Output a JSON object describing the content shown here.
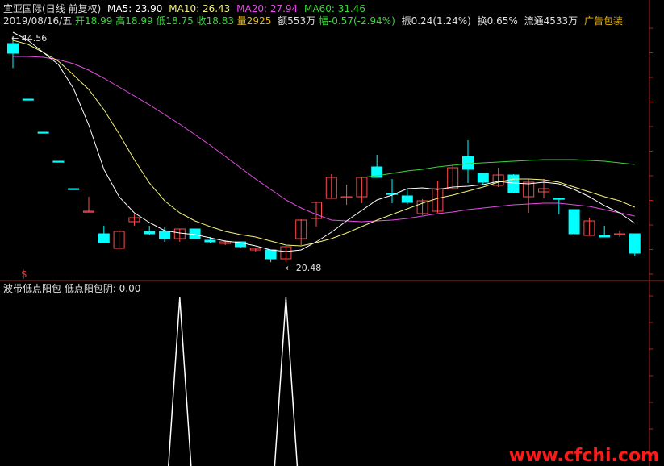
{
  "header": {
    "stock_title": "宜亚国际(日线 前复权)",
    "ma5": "MA5: 23.90",
    "ma10": "MA10: 26.43",
    "ma20": "MA20: 27.94",
    "ma60": "MA60: 31.46",
    "date": "2019/08/16/五",
    "open": "开18.99",
    "high": "高18.99",
    "low": "低18.75",
    "close": "收18.83",
    "volume": "量2925",
    "amount": "额553万",
    "change": "幅-0.57(-2.94%)",
    "amplitude": "振0.24(1.24%)",
    "turnover": "换0.65%",
    "float": "流通4533万",
    "industry": "广告包装"
  },
  "markers": {
    "high_label": "44.56",
    "low_label": "20.48",
    "dollar": "$"
  },
  "indicator": {
    "title": "波带低点阳包  低点阳包阴: 0.00"
  },
  "watermark": "www.cfchi.com",
  "colors": {
    "background": "#000000",
    "up": "#ff4b4b",
    "down": "#00ffff",
    "ma5": "#ffffff",
    "ma10": "#f5f37c",
    "ma20": "#e34ee3",
    "ma60": "#3ad63a",
    "axis": "#b22222"
  },
  "chart_data": {
    "type": "candlestick",
    "title": "宜亚国际(日线 前复权)",
    "candles": [
      {
        "o": 47.6,
        "h": 48.5,
        "l": 44.56,
        "c": 46.4,
        "dir": "down"
      },
      {
        "o": 40.7,
        "h": 40.7,
        "l": 40.7,
        "c": 40.7,
        "dir": "down"
      },
      {
        "o": 36.6,
        "h": 36.6,
        "l": 36.6,
        "c": 36.6,
        "dir": "down"
      },
      {
        "o": 33.0,
        "h": 33.0,
        "l": 33.0,
        "c": 33.0,
        "dir": "down"
      },
      {
        "o": 29.6,
        "h": 29.6,
        "l": 29.6,
        "c": 29.6,
        "dir": "down"
      },
      {
        "o": 26.7,
        "h": 28.6,
        "l": 26.7,
        "c": 26.8,
        "dir": "up"
      },
      {
        "o": 24.0,
        "h": 25.0,
        "l": 23.0,
        "c": 22.9,
        "dir": "down"
      },
      {
        "o": 22.2,
        "h": 24.6,
        "l": 22.2,
        "c": 24.3,
        "dir": "up"
      },
      {
        "o": 25.5,
        "h": 26.4,
        "l": 25.0,
        "c": 26.0,
        "dir": "up"
      },
      {
        "o": 24.3,
        "h": 25.0,
        "l": 23.8,
        "c": 24.0,
        "dir": "down"
      },
      {
        "o": 24.3,
        "h": 24.9,
        "l": 23.0,
        "c": 23.4,
        "dir": "down"
      },
      {
        "o": 23.4,
        "h": 24.6,
        "l": 23.0,
        "c": 24.6,
        "dir": "up"
      },
      {
        "o": 24.6,
        "h": 24.6,
        "l": 23.4,
        "c": 23.4,
        "dir": "down"
      },
      {
        "o": 23.2,
        "h": 23.6,
        "l": 22.8,
        "c": 23.0,
        "dir": "down"
      },
      {
        "o": 23.0,
        "h": 23.2,
        "l": 22.6,
        "c": 22.8,
        "dir": "up"
      },
      {
        "o": 23.0,
        "h": 23.0,
        "l": 22.2,
        "c": 22.4,
        "dir": "down"
      },
      {
        "o": 22.2,
        "h": 22.2,
        "l": 21.8,
        "c": 22.0,
        "dir": "up"
      },
      {
        "o": 22.0,
        "h": 22.0,
        "l": 20.48,
        "c": 20.9,
        "dir": "down"
      },
      {
        "o": 20.9,
        "h": 22.5,
        "l": 20.5,
        "c": 22.4,
        "dir": "up"
      },
      {
        "o": 23.4,
        "h": 25.8,
        "l": 22.6,
        "c": 25.7,
        "dir": "up"
      },
      {
        "o": 25.9,
        "h": 28.0,
        "l": 24.9,
        "c": 27.9,
        "dir": "up"
      },
      {
        "o": 28.4,
        "h": 31.4,
        "l": 28.4,
        "c": 31.0,
        "dir": "up"
      },
      {
        "o": 28.6,
        "h": 30.1,
        "l": 27.6,
        "c": 28.6,
        "dir": "up"
      },
      {
        "o": 28.6,
        "h": 31.0,
        "l": 27.8,
        "c": 31.0,
        "dir": "up"
      },
      {
        "o": 32.3,
        "h": 33.8,
        "l": 31.4,
        "c": 31.0,
        "dir": "down"
      },
      {
        "o": 29.0,
        "h": 30.8,
        "l": 27.8,
        "c": 29.0,
        "dir": "down"
      },
      {
        "o": 28.7,
        "h": 29.5,
        "l": 27.7,
        "c": 27.9,
        "dir": "down"
      },
      {
        "o": 26.5,
        "h": 28.3,
        "l": 26.3,
        "c": 28.1,
        "dir": "up"
      },
      {
        "o": 26.8,
        "h": 30.6,
        "l": 26.6,
        "c": 29.6,
        "dir": "up"
      },
      {
        "o": 29.6,
        "h": 32.6,
        "l": 29.6,
        "c": 32.2,
        "dir": "up"
      },
      {
        "o": 33.6,
        "h": 35.6,
        "l": 30.3,
        "c": 32.0,
        "dir": "down"
      },
      {
        "o": 31.5,
        "h": 31.5,
        "l": 30.0,
        "c": 30.4,
        "dir": "down"
      },
      {
        "o": 30.0,
        "h": 32.2,
        "l": 29.8,
        "c": 31.3,
        "dir": "up"
      },
      {
        "o": 31.3,
        "h": 31.4,
        "l": 29.0,
        "c": 29.1,
        "dir": "down"
      },
      {
        "o": 28.6,
        "h": 30.8,
        "l": 26.6,
        "c": 30.4,
        "dir": "up"
      },
      {
        "o": 29.2,
        "h": 30.8,
        "l": 28.4,
        "c": 29.6,
        "dir": "up"
      },
      {
        "o": 28.4,
        "h": 28.4,
        "l": 26.4,
        "c": 28.4,
        "dir": "down"
      },
      {
        "o": 27.0,
        "h": 27.0,
        "l": 23.8,
        "c": 24.0,
        "dir": "down"
      },
      {
        "o": 23.8,
        "h": 26.0,
        "l": 23.8,
        "c": 25.6,
        "dir": "up"
      },
      {
        "o": 23.8,
        "h": 25.0,
        "l": 23.6,
        "c": 23.6,
        "dir": "down"
      },
      {
        "o": 24.0,
        "h": 24.4,
        "l": 23.6,
        "c": 24.0,
        "dir": "up"
      },
      {
        "o": 24.0,
        "h": 24.0,
        "l": 21.3,
        "c": 21.6,
        "dir": "down"
      }
    ],
    "ma5": [
      49.0,
      48.0,
      46.5,
      45.0,
      42.0,
      37.5,
      32.0,
      28.6,
      26.6,
      25.4,
      24.4,
      24.1,
      23.9,
      23.5,
      23.1,
      22.9,
      22.5,
      22.0,
      21.8,
      22.0,
      23.0,
      24.2,
      25.6,
      26.9,
      28.2,
      28.8,
      29.6,
      29.7,
      29.5,
      29.8,
      29.9,
      30.1,
      30.5,
      30.3,
      30.2,
      30.4,
      30.2,
      29.5,
      28.6,
      27.5,
      26.6,
      25.3
    ],
    "ma10": [
      48.0,
      47.5,
      46.5,
      45.4,
      43.7,
      41.9,
      39.4,
      36.4,
      33.2,
      30.3,
      28.1,
      26.6,
      25.6,
      24.9,
      24.3,
      23.9,
      23.6,
      23.1,
      22.6,
      22.5,
      22.9,
      23.4,
      24.1,
      24.9,
      25.7,
      26.4,
      27.1,
      27.8,
      28.4,
      28.8,
      29.3,
      29.8,
      30.4,
      30.8,
      30.8,
      30.7,
      30.4,
      29.8,
      29.2,
      28.6,
      28.1,
      27.3
    ],
    "ma20": [
      46.0,
      46.0,
      45.9,
      45.6,
      45.1,
      44.3,
      43.3,
      42.2,
      41.1,
      40.0,
      38.8,
      37.6,
      36.3,
      35.0,
      33.6,
      32.2,
      30.8,
      29.5,
      28.2,
      27.2,
      26.4,
      25.7,
      25.6,
      25.5,
      25.6,
      25.7,
      25.9,
      26.2,
      26.5,
      26.7,
      27.0,
      27.2,
      27.4,
      27.6,
      27.7,
      27.8,
      27.8,
      27.6,
      27.4,
      27.0,
      26.6,
      26.2
    ],
    "ma60_start_index": 23,
    "ma60": [
      31.0,
      31.2,
      31.5,
      31.8,
      32.0,
      32.3,
      32.5,
      32.7,
      32.8,
      32.9,
      33.0,
      33.1,
      33.2,
      33.2,
      33.2,
      33.1,
      33.0,
      32.8,
      32.6
    ],
    "ylim": [
      19.0,
      50.0
    ],
    "indicator_series": [
      0,
      0,
      0,
      0,
      0,
      0,
      0,
      0,
      0,
      0,
      0,
      1,
      0,
      0,
      0,
      0,
      0,
      0,
      1,
      0,
      0,
      0,
      0,
      0,
      0,
      0,
      0,
      0,
      0,
      0,
      0,
      0,
      0,
      0,
      0,
      0,
      0,
      0,
      0,
      0,
      0,
      0
    ]
  }
}
